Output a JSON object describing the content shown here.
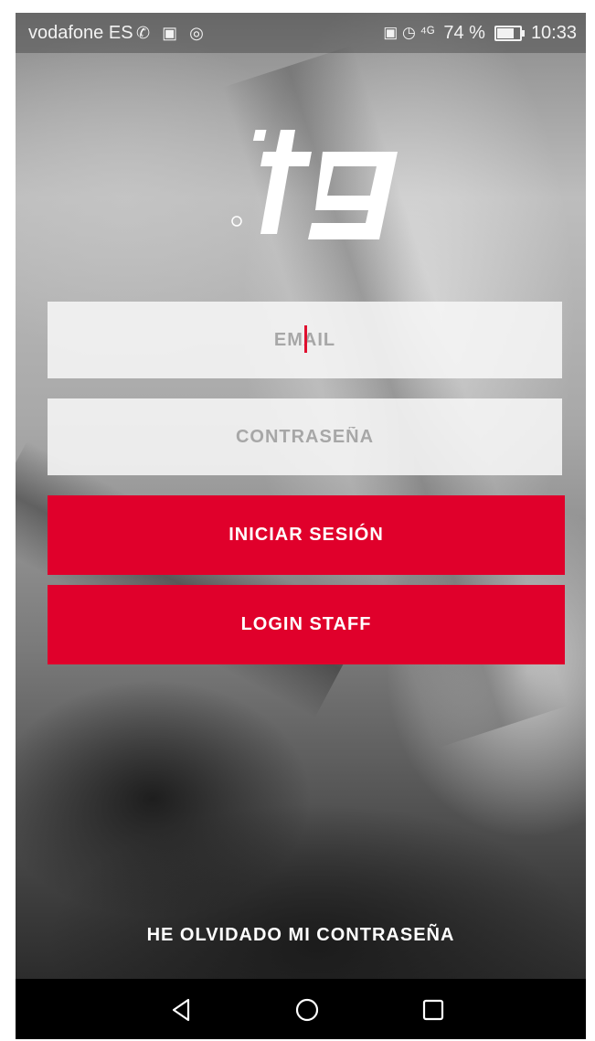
{
  "status_bar": {
    "carrier": "vodafone ES",
    "left_icons": "✆ ▣ ◎",
    "right_icons": "▣ ◷ ⁴ᴳ",
    "battery_percent": "74 %",
    "battery_level": 0.74,
    "time": "10:33"
  },
  "logo": {
    "text": "tg",
    "icon": "tg-logo"
  },
  "form": {
    "email_placeholder": "EMAIL",
    "password_placeholder": "CONTRASEÑA",
    "login_label": "INICIAR SESIÓN",
    "staff_label": "LOGIN STAFF",
    "forgot_label": "HE OLVIDADO MI CONTRASEÑA"
  },
  "colors": {
    "primary_button": "#e0002b",
    "cursor": "#e0102f",
    "input_background": "#f6f6f6"
  },
  "navigation": {
    "back_icon": "back-triangle-icon",
    "home_icon": "home-circle-icon",
    "recent_icon": "recent-apps-square-icon"
  }
}
